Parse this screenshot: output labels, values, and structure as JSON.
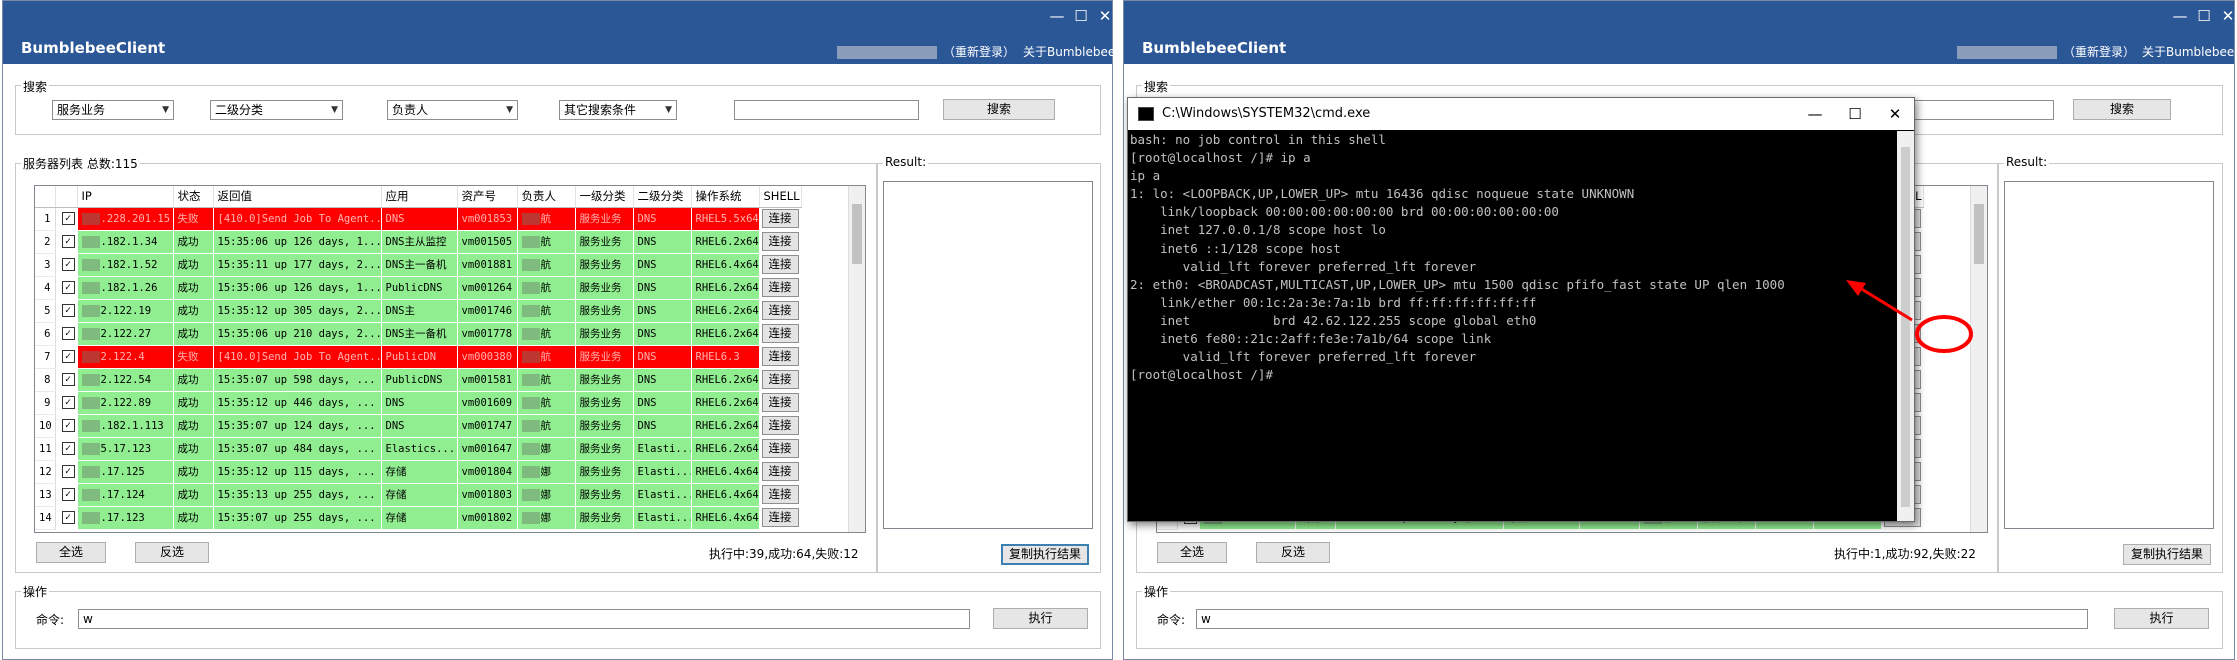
{
  "app_title": "BumblebeeClient",
  "relogin": "（重新登录）",
  "about": "关于Bumblebee",
  "search_group": "搜索",
  "filters": [
    "服务业务",
    "二级分类",
    "负责人",
    "其它搜索条件"
  ],
  "search_btn": "搜索",
  "list_label": "服务器列表 总数:115",
  "result_label": "Result:",
  "columns": [
    "",
    "",
    "IP",
    "状态",
    "返回值",
    "应用",
    "资产号",
    "负责人",
    "一级分类",
    "二级分类",
    "操作系统",
    "SHELL"
  ],
  "connect": "连接",
  "rows": [
    {
      "n": "1",
      "ip": ".228.201.15",
      "st": "失败",
      "ret": "[410.0]Send Job To Agent...",
      "app": "DNS",
      "asset": "vm001853",
      "owner": "航",
      "c1": "服务业务",
      "c2": "DNS",
      "os": "RHEL5.5x64",
      "fail": true
    },
    {
      "n": "2",
      "ip": ".182.1.34",
      "st": "成功",
      "ret": "15:35:06 up 126 days, 1...",
      "app": "DNS主从监控",
      "asset": "vm001505",
      "owner": "航",
      "c1": "服务业务",
      "c2": "DNS",
      "os": "RHEL6.2x64",
      "fail": false
    },
    {
      "n": "3",
      "ip": ".182.1.52",
      "st": "成功",
      "ret": "15:35:11 up 177 days, 2...",
      "app": "DNS主一备机",
      "asset": "vm001881",
      "owner": "航",
      "c1": "服务业务",
      "c2": "DNS",
      "os": "RHEL6.4x64",
      "fail": false
    },
    {
      "n": "4",
      "ip": ".182.1.26",
      "st": "成功",
      "ret": "15:35:06 up 126 days, 1...",
      "app": "PublicDNS",
      "asset": "vm001264",
      "owner": "航",
      "c1": "服务业务",
      "c2": "DNS",
      "os": "RHEL6.2x64",
      "fail": false
    },
    {
      "n": "5",
      "ip": "2.122.19",
      "st": "成功",
      "ret": "15:35:12 up 305 days, 2...",
      "app": "DNS主",
      "asset": "vm001746",
      "owner": "航",
      "c1": "服务业务",
      "c2": "DNS",
      "os": "RHEL6.2x64",
      "fail": false
    },
    {
      "n": "6",
      "ip": "2.122.27",
      "st": "成功",
      "ret": "15:35:06 up 210 days, 2...",
      "app": "DNS主一备机",
      "asset": "vm001778",
      "owner": "航",
      "c1": "服务业务",
      "c2": "DNS",
      "os": "RHEL6.2x64",
      "fail": false
    },
    {
      "n": "7",
      "ip": "2.122.4",
      "st": "失败",
      "ret": "[410.0]Send Job To Agent...",
      "app": "PublicDN",
      "asset": "vm000380",
      "owner": "航",
      "c1": "服务业务",
      "c2": "DNS",
      "os": "RHEL6.3",
      "fail": true
    },
    {
      "n": "8",
      "ip": "2.122.54",
      "st": "成功",
      "ret": "15:35:07 up 598 days, ...",
      "app": "PublicDNS",
      "asset": "vm001581",
      "owner": "航",
      "c1": "服务业务",
      "c2": "DNS",
      "os": "RHEL6.2x64",
      "fail": false
    },
    {
      "n": "9",
      "ip": "2.122.89",
      "st": "成功",
      "ret": "15:35:12 up 446 days, ...",
      "app": "DNS",
      "asset": "vm001609",
      "owner": "航",
      "c1": "服务业务",
      "c2": "DNS",
      "os": "RHEL6.2x64",
      "fail": false
    },
    {
      "n": "10",
      "ip": ".182.1.113",
      "st": "成功",
      "ret": "15:35:07 up 124 days, ...",
      "app": "DNS",
      "asset": "vm001747",
      "owner": "航",
      "c1": "服务业务",
      "c2": "DNS",
      "os": "RHEL6.2x64",
      "fail": false
    },
    {
      "n": "11",
      "ip": "5.17.123",
      "st": "成功",
      "ret": "15:35:07 up 484 days, ...",
      "app": "Elastics...",
      "asset": "vm001647",
      "owner": "娜",
      "c1": "服务业务",
      "c2": "Elasti...",
      "os": "RHEL6.2x64",
      "fail": false
    },
    {
      "n": "12",
      "ip": ".17.125",
      "st": "成功",
      "ret": "15:35:12 up 115 days, ...",
      "app": "存储",
      "asset": "vm001804",
      "owner": "娜",
      "c1": "服务业务",
      "c2": "Elasti...",
      "os": "RHEL6.4x64",
      "fail": false
    },
    {
      "n": "13",
      "ip": ".17.124",
      "st": "成功",
      "ret": "15:35:13 up 255 days, ...",
      "app": "存储",
      "asset": "vm001803",
      "owner": "娜",
      "c1": "服务业务",
      "c2": "Elasti...",
      "os": "RHEL6.4x64",
      "fail": false
    },
    {
      "n": "14",
      "ip": ".17.123",
      "st": "成功",
      "ret": "15:35:07 up 255 days, ...",
      "app": "存储",
      "asset": "vm001802",
      "owner": "娜",
      "c1": "服务业务",
      "c2": "Elasti...",
      "os": "RHEL6.4x64",
      "fail": false
    }
  ],
  "select_all": "全选",
  "invert": "反选",
  "status_left": "执行中:39,成功:64,失败:12",
  "status_right": "执行中:1,成功:92,失败:22",
  "copy_btn": "复制执行结果",
  "op_group": "操作",
  "cmd_label": "命令:",
  "cmd_value": "w",
  "exec_btn": "执行",
  "cmd_window_title": "C:\\Windows\\SYSTEM32\\cmd.exe",
  "cmd_lines": [
    "bash: no job control in this shell",
    "[root@localhost /]# ip a",
    "ip a",
    "1: lo: <LOOPBACK,UP,LOWER_UP> mtu 16436 qdisc noqueue state UNKNOWN",
    "    link/loopback 00:00:00:00:00:00 brd 00:00:00:00:00:00",
    "    inet 127.0.0.1/8 scope host lo",
    "    inet6 ::1/128 scope host",
    "       valid_lft forever preferred_lft forever",
    "2: eth0: <BROADCAST,MULTICAST,UP,LOWER_UP> mtu 1500 qdisc pfifo_fast state UP qlen 1000",
    "    link/ether 00:1c:2a:3e:7a:1b brd ff:ff:ff:ff:ff:ff",
    "    inet           brd 42.62.122.255 scope global eth0",
    "    inet6 fe80::21c:2aff:fe3e:7a1b/64 scope link",
    "       valid_lft forever preferred_lft forever",
    "[root@localhost /]#"
  ],
  "colors": {
    "title": "#2b5797",
    "ok": "#90ee90",
    "fail": "#ff0000",
    "annot": "#ff0000"
  }
}
